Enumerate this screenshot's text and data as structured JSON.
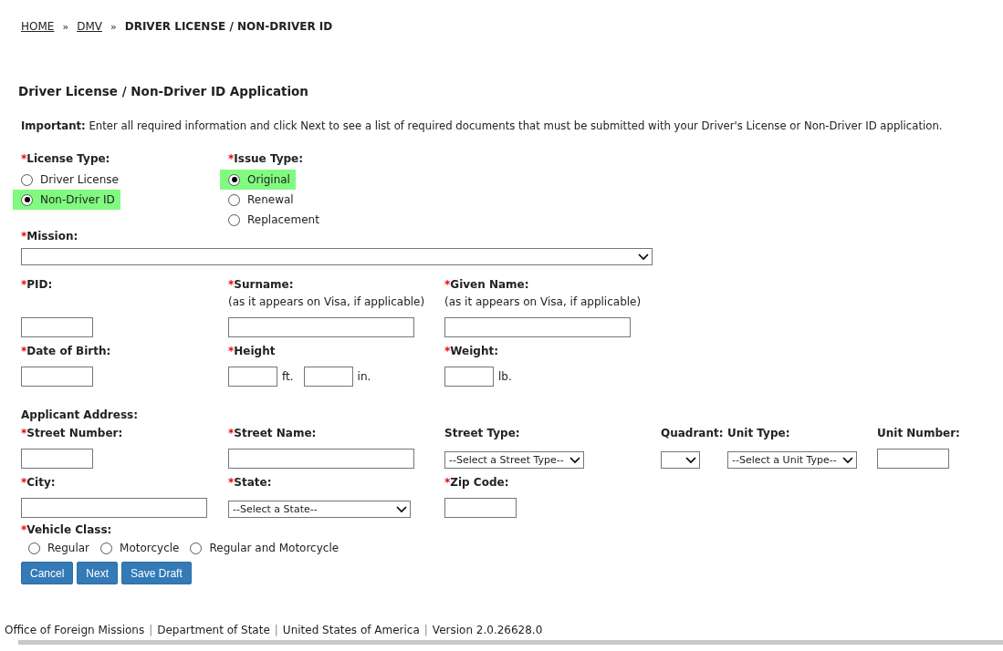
{
  "breadcrumb": [
    {
      "kind": "link",
      "text": "HOME"
    },
    {
      "kind": "sep",
      "text": "»"
    },
    {
      "kind": "link",
      "text": "DMV"
    },
    {
      "kind": "sep",
      "text": "»"
    },
    {
      "kind": "current",
      "text": "DRIVER LICENSE / NON-DRIVER ID"
    }
  ],
  "title": "Driver License / Non-Driver ID Application",
  "notice": "**Important:** Enter all required information and click Next to see a list of required documents that must be submitted with your Driver's License or Non-Driver ID application.",
  "radio_groups": [
    {
      "asterisk": "*",
      "label": "License Type:",
      "options": [
        {
          "label": "Driver License",
          "selected": false
        },
        {
          "label": "Non-Driver ID",
          "selected": true
        }
      ]
    },
    {
      "asterisk": "*",
      "label": "Issue Type:",
      "options": [
        {
          "label": "Original",
          "selected": true
        },
        {
          "label": "Renewal",
          "selected": false
        },
        {
          "label": "Replacement",
          "selected": false
        }
      ]
    }
  ],
  "mission": {
    "asterisk": "*",
    "label": "Mission:"
  },
  "rows": [
    {
      "fields": [
        {
          "asterisk": "*",
          "label": "PID:",
          "kind": "short"
        },
        {
          "asterisk": "*",
          "label": "Surname:",
          "hint": "(as it appears on Visa, if applicable)",
          "kind": "long"
        },
        {
          "asterisk": "*",
          "label": "Given Name:",
          "hint": "(as it appears on Visa, if applicable)",
          "kind": "long"
        }
      ]
    },
    {
      "fields": [
        {
          "asterisk": "*",
          "label": "Date of Birth:",
          "kind": "short"
        },
        {
          "asterisk": "*",
          "label": "Height",
          "kind": "measure",
          "units": [
            "ft.",
            "in."
          ]
        },
        {
          "asterisk": "*",
          "label": "Weight:",
          "kind": "measure",
          "units": [
            "lb."
          ]
        }
      ]
    },
    {
      "heading": "Applicant Address:",
      "fields": [
        {
          "asterisk": "*",
          "label": "Street Number:",
          "kind": "short"
        },
        {
          "asterisk": "*",
          "label": "Street Name:",
          "kind": "long"
        },
        {
          "label": "Street Type:",
          "kind": "select",
          "value": "--Select a Street Type--"
        },
        {
          "label": "Quadrant:",
          "kind": "select"
        },
        {
          "label": "Unit Type:",
          "kind": "select",
          "value": "--Select a Unit Type--"
        },
        {
          "label": "Unit Number:",
          "kind": "short"
        }
      ]
    },
    {
      "fields": [
        {
          "asterisk": "*",
          "label": "City:",
          "kind": "long"
        },
        {
          "asterisk": "*",
          "label": "State:",
          "kind": "select",
          "value": "--Select a State--"
        },
        {
          "asterisk": "*",
          "label": "Zip Code:",
          "kind": "short"
        }
      ]
    }
  ],
  "vehicle_class": {
    "asterisk": "*",
    "label": "Vehicle Class:",
    "options": [
      {
        "label": "Regular",
        "selected": false
      },
      {
        "label": "Motorcycle",
        "selected": false
      },
      {
        "label": "Regular and Motorcycle",
        "selected": false
      }
    ]
  },
  "buttons": [
    "Cancel",
    "Next",
    "Save Draft"
  ],
  "footer": [
    {
      "kind": "text",
      "text": "Office of Foreign Missions"
    },
    {
      "kind": "sep",
      "text": "|"
    },
    {
      "kind": "text",
      "text": "Department of State"
    },
    {
      "kind": "sep",
      "text": "|"
    },
    {
      "kind": "text",
      "text": "United States of America"
    },
    {
      "kind": "sep",
      "text": "|"
    },
    {
      "kind": "text",
      "text": "Version 2.0.26628.0"
    }
  ]
}
